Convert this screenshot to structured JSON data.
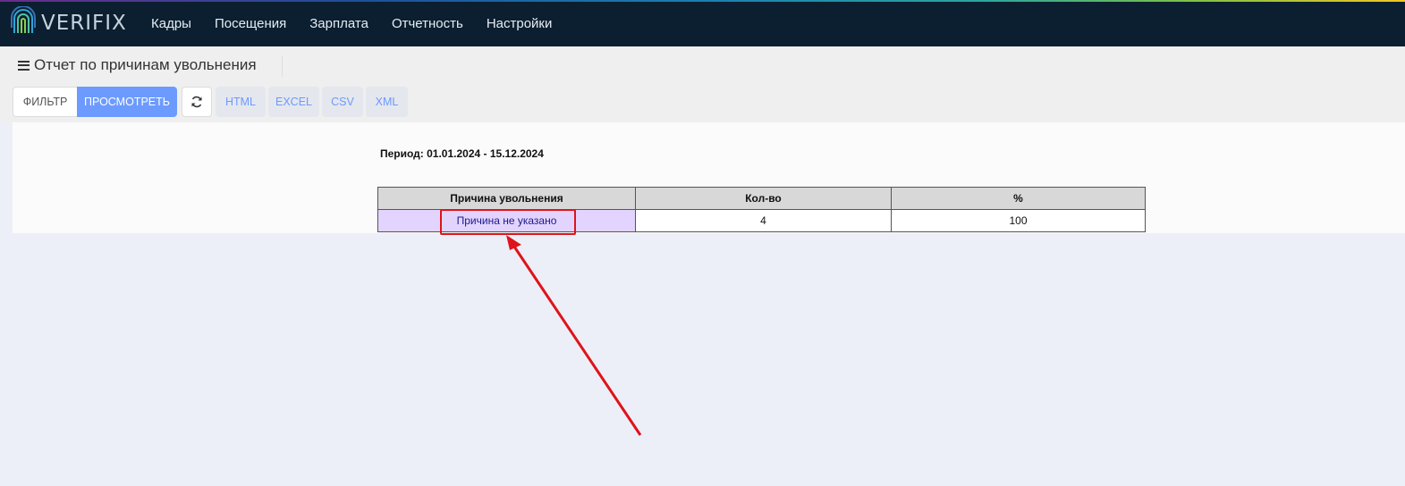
{
  "app": {
    "logo_text": "VERIFIX"
  },
  "nav": [
    {
      "label": "Кадры"
    },
    {
      "label": "Посещения"
    },
    {
      "label": "Зарплата"
    },
    {
      "label": "Отчетность"
    },
    {
      "label": "Настройки"
    }
  ],
  "page": {
    "title": "Отчет по причинам увольнения"
  },
  "toolbar": {
    "filter_label": "ФИЛЬТР",
    "view_label": "ПРОСМОТРЕТЬ",
    "refresh_icon": "refresh-icon",
    "exports": [
      {
        "label": "HTML"
      },
      {
        "label": "EXCEL"
      },
      {
        "label": "CSV"
      },
      {
        "label": "XML"
      }
    ]
  },
  "report": {
    "period": "Период: 01.01.2024 - 15.12.2024",
    "columns": [
      "Причина увольнения",
      "Кол-во",
      "%"
    ],
    "rows": [
      {
        "reason": "Причина не указано",
        "count": "4",
        "percent": "100"
      }
    ]
  },
  "colors": {
    "topbar": "#0b1f30",
    "accent": "#6c9aff",
    "highlight": "#e0131a",
    "reason_cell": "#e3d4ff"
  }
}
